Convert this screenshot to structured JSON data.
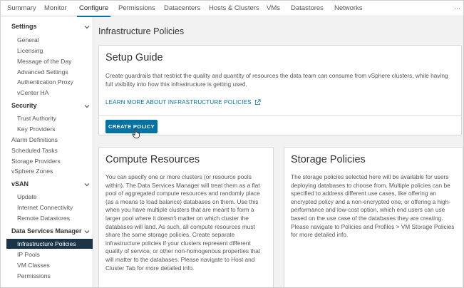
{
  "topnav": {
    "tabs": [
      {
        "label": "Summary",
        "active": false
      },
      {
        "label": "Monitor",
        "active": false
      },
      {
        "label": "Configure",
        "active": true
      },
      {
        "label": "Permissions",
        "active": false
      },
      {
        "label": "Datacenters",
        "active": false
      },
      {
        "label": "Hosts & Clusters",
        "active": false
      },
      {
        "label": "VMs",
        "active": false
      },
      {
        "label": "Datastores",
        "active": false
      },
      {
        "label": "Networks",
        "active": false
      }
    ],
    "overflow": "⋯"
  },
  "sidebar": {
    "settings": {
      "header": "Settings",
      "items": [
        "General",
        "Licensing",
        "Message of the Day",
        "Advanced Settings",
        "Authentication Proxy",
        "vCenter HA"
      ]
    },
    "security": {
      "header": "Security",
      "items": [
        "Trust Authority",
        "Key Providers"
      ]
    },
    "standalone": [
      "Alarm Definitions",
      "Scheduled Tasks",
      "Storage Providers",
      "vSphere Zones"
    ],
    "vsan": {
      "header": "vSAN",
      "items": [
        "Update",
        "Internet Connectivity",
        "Remote Datastores"
      ]
    },
    "dsm": {
      "header": "Data Services Manager",
      "items": [
        "Infrastructure Policies",
        "IP Pools",
        "VM Classes",
        "Permissions"
      ],
      "selected": "Infrastructure Policies"
    }
  },
  "main": {
    "title": "Infrastructure Policies",
    "setup_guide": {
      "title": "Setup Guide",
      "text": "Create guardrails that restrict the quality and quantity of resources the data team can consume from vSphere clusters, while having full visibility into how this infrastructure is getting used.",
      "link": "LEARN MORE ABOUT INFRASTRUCTURE POLICIES",
      "button": "CREATE POLICY"
    },
    "compute": {
      "title": "Compute Resources",
      "text": "You can specify one or more clusters (or resource pools within). The Data Services Manager will treat them as a flat pool of aggregated compute resources and randomly place (as a means to load balance) databases on them. Use this when you have multiple clusters that are meant to form a larger pool where it doesn't matter on which cluster the databases will land. As such, all compute resources must share the same storage policies. Create separate infrastructure policies if your clusters represent different quality of service; or other non-homogenous properties that will matter to the databases. Please navigate to Host and Cluster Tab for more detailed info."
    },
    "storage": {
      "title": "Storage Policies",
      "text": "The storage policies selected here will be available for users deploying databases to choose from. Multiple policies can be specified to address different use cases, like offering an encrypted policy and a non-encrypted one, or offering a high-performance and low-cost option, which end users can use based on the use case of the databases they are creating. Please navigate to Policies and Profiles > VM Storage Policies for more detailed info."
    }
  },
  "colors": {
    "accent": "#0072a3",
    "selected_bg": "#1b3447",
    "main_bg": "#f2f2f2"
  }
}
